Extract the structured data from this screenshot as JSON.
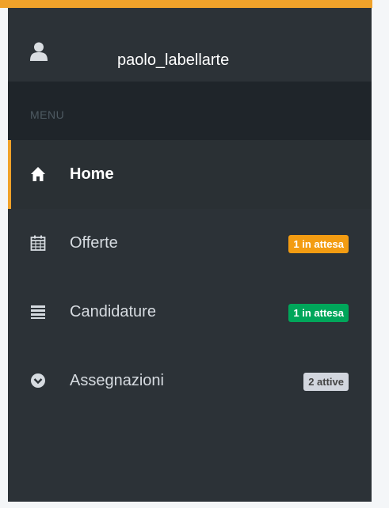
{
  "user": {
    "name": "paolo_labellarte",
    "icon": "user-icon"
  },
  "menu": {
    "header": "MENU"
  },
  "nav": [
    {
      "label": "Home",
      "icon": "home-icon",
      "active": true
    },
    {
      "label": "Offerte",
      "icon": "calendar-icon",
      "badge": "1 in attesa",
      "badge_color": "#f39c12"
    },
    {
      "label": "Candidature",
      "icon": "list-icon",
      "badge": "1 in attesa",
      "badge_color": "#00a65a"
    },
    {
      "label": "Assegnazioni",
      "icon": "chevron-circle-down-icon",
      "badge": "2 attive",
      "badge_color": "#d2d6de"
    }
  ],
  "colors": {
    "accent": "#f0a22a",
    "sidebar": "#2c3237",
    "menu_header_bg": "#1f252a"
  }
}
